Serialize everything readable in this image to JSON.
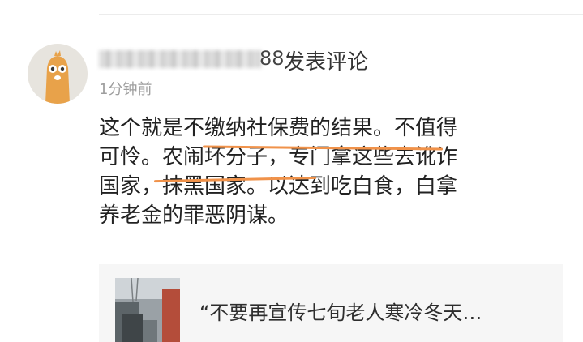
{
  "comment": {
    "username_suffix": "88",
    "action": "发表评论",
    "time": "1分钟前",
    "lines": [
      "这个就是不缴纳社保费的结果。不值得",
      "可怜。农闹坏分子，专门拿这些去讹诈",
      "国家，抹黑国家。以达到吃白食，白拿",
      "养老金的罪恶阴谋。"
    ]
  },
  "preview": {
    "text": "“不要再宣传七旬老人寒冷冬天…"
  },
  "colors": {
    "underline": "#f0924a",
    "avatar_bg": "#e7e4de",
    "avatar_figure": "#e8a24a"
  }
}
